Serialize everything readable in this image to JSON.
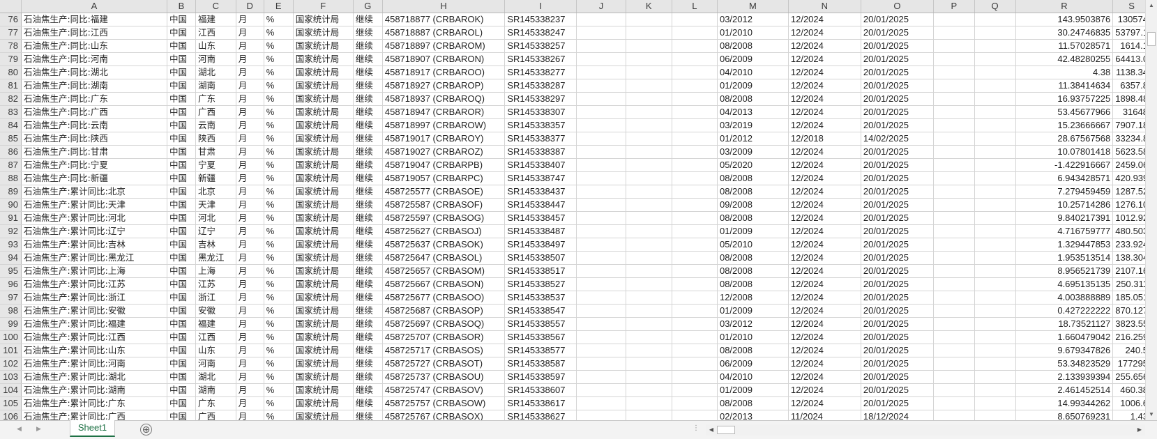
{
  "columns": [
    "A",
    "B",
    "C",
    "D",
    "E",
    "F",
    "G",
    "H",
    "I",
    "J",
    "K",
    "L",
    "M",
    "N",
    "O",
    "P",
    "Q",
    "R",
    "S"
  ],
  "rows": [
    {
      "n": "76",
      "a": "石油焦生产:同比:福建",
      "b": "中国",
      "c": "福建",
      "d": "月",
      "e": "%",
      "f": "国家统计局",
      "g": "继续",
      "h": "458718877 (CRBAROK)",
      "i": "SR145338237",
      "m": "03/2012",
      "nn": "12/2024",
      "o": "20/01/2025",
      "r": "143.9503876",
      "s": "130574"
    },
    {
      "n": "77",
      "a": "石油焦生产:同比:江西",
      "b": "中国",
      "c": "江西",
      "d": "月",
      "e": "%",
      "f": "国家统计局",
      "g": "继续",
      "h": "458718887 (CRBAROL)",
      "i": "SR145338247",
      "m": "01/2010",
      "nn": "12/2024",
      "o": "20/01/2025",
      "r": "30.24746835",
      "s": "53797.1"
    },
    {
      "n": "78",
      "a": "石油焦生产:同比:山东",
      "b": "中国",
      "c": "山东",
      "d": "月",
      "e": "%",
      "f": "国家统计局",
      "g": "继续",
      "h": "458718897 (CRBAROM)",
      "i": "SR145338257",
      "m": "08/2008",
      "nn": "12/2024",
      "o": "20/01/2025",
      "r": "11.57028571",
      "s": "1614.1"
    },
    {
      "n": "79",
      "a": "石油焦生产:同比:河南",
      "b": "中国",
      "c": "河南",
      "d": "月",
      "e": "%",
      "f": "国家统计局",
      "g": "继续",
      "h": "458718907 (CRBARON)",
      "i": "SR145338267",
      "m": "06/2009",
      "nn": "12/2024",
      "o": "20/01/2025",
      "r": "42.48280255",
      "s": "64413.0"
    },
    {
      "n": "80",
      "a": "石油焦生产:同比:湖北",
      "b": "中国",
      "c": "湖北",
      "d": "月",
      "e": "%",
      "f": "国家统计局",
      "g": "继续",
      "h": "458718917 (CRBAROO)",
      "i": "SR145338277",
      "m": "04/2010",
      "nn": "12/2024",
      "o": "20/01/2025",
      "r": "4.38",
      "s": "1138.34"
    },
    {
      "n": "81",
      "a": "石油焦生产:同比:湖南",
      "b": "中国",
      "c": "湖南",
      "d": "月",
      "e": "%",
      "f": "国家统计局",
      "g": "继续",
      "h": "458718927 (CRBAROP)",
      "i": "SR145338287",
      "m": "01/2009",
      "nn": "12/2024",
      "o": "20/01/2025",
      "r": "11.38414634",
      "s": "6357.8"
    },
    {
      "n": "82",
      "a": "石油焦生产:同比:广东",
      "b": "中国",
      "c": "广东",
      "d": "月",
      "e": "%",
      "f": "国家统计局",
      "g": "继续",
      "h": "458718937 (CRBAROQ)",
      "i": "SR145338297",
      "m": "08/2008",
      "nn": "12/2024",
      "o": "20/01/2025",
      "r": "16.93757225",
      "s": "1898.48"
    },
    {
      "n": "83",
      "a": "石油焦生产:同比:广西",
      "b": "中国",
      "c": "广西",
      "d": "月",
      "e": "%",
      "f": "国家统计局",
      "g": "继续",
      "h": "458718947 (CRBAROR)",
      "i": "SR145338307",
      "m": "04/2013",
      "nn": "12/2024",
      "o": "20/01/2025",
      "r": "53.45677966",
      "s": "31648"
    },
    {
      "n": "84",
      "a": "石油焦生产:同比:云南",
      "b": "中国",
      "c": "云南",
      "d": "月",
      "e": "%",
      "f": "国家统计局",
      "g": "继续",
      "h": "458718997 (CRBAROW)",
      "i": "SR145338357",
      "m": "03/2019",
      "nn": "12/2024",
      "o": "20/01/2025",
      "r": "15.23666667",
      "s": "7907.18"
    },
    {
      "n": "85",
      "a": "石油焦生产:同比:陕西",
      "b": "中国",
      "c": "陕西",
      "d": "月",
      "e": "%",
      "f": "国家统计局",
      "g": "继续",
      "h": "458719017 (CRBAROY)",
      "i": "SR145338377",
      "m": "01/2012",
      "nn": "12/2018",
      "o": "14/02/2025",
      "r": "28.67567568",
      "s": "33234.8"
    },
    {
      "n": "86",
      "a": "石油焦生产:同比:甘肃",
      "b": "中国",
      "c": "甘肃",
      "d": "月",
      "e": "%",
      "f": "国家统计局",
      "g": "继续",
      "h": "458719027 (CRBAROZ)",
      "i": "SR145338387",
      "m": "03/2009",
      "nn": "12/2024",
      "o": "20/01/2025",
      "r": "10.07801418",
      "s": "5623.58"
    },
    {
      "n": "87",
      "a": "石油焦生产:同比:宁夏",
      "b": "中国",
      "c": "宁夏",
      "d": "月",
      "e": "%",
      "f": "国家统计局",
      "g": "继续",
      "h": "458719047 (CRBARPB)",
      "i": "SR145338407",
      "m": "05/2020",
      "nn": "12/2024",
      "o": "20/01/2025",
      "r": "-1.422916667",
      "s": "2459.06"
    },
    {
      "n": "88",
      "a": "石油焦生产:同比:新疆",
      "b": "中国",
      "c": "新疆",
      "d": "月",
      "e": "%",
      "f": "国家统计局",
      "g": "继续",
      "h": "458719057 (CRBARPC)",
      "i": "SR145338747",
      "m": "08/2008",
      "nn": "12/2024",
      "o": "20/01/2025",
      "r": "6.943428571",
      "s": "420.939"
    },
    {
      "n": "89",
      "a": "石油焦生产:累计同比:北京",
      "b": "中国",
      "c": "北京",
      "d": "月",
      "e": "%",
      "f": "国家统计局",
      "g": "继续",
      "h": "458725577 (CRBASOE)",
      "i": "SR145338437",
      "m": "08/2008",
      "nn": "12/2024",
      "o": "20/01/2025",
      "r": "7.279459459",
      "s": "1287.52"
    },
    {
      "n": "90",
      "a": "石油焦生产:累计同比:天津",
      "b": "中国",
      "c": "天津",
      "d": "月",
      "e": "%",
      "f": "国家统计局",
      "g": "继续",
      "h": "458725587 (CRBASOF)",
      "i": "SR145338447",
      "m": "09/2008",
      "nn": "12/2024",
      "o": "20/01/2025",
      "r": "10.25714286",
      "s": "1276.10"
    },
    {
      "n": "91",
      "a": "石油焦生产:累计同比:河北",
      "b": "中国",
      "c": "河北",
      "d": "月",
      "e": "%",
      "f": "国家统计局",
      "g": "继续",
      "h": "458725597 (CRBASOG)",
      "i": "SR145338457",
      "m": "08/2008",
      "nn": "12/2024",
      "o": "20/01/2025",
      "r": "9.840217391",
      "s": "1012.92"
    },
    {
      "n": "92",
      "a": "石油焦生产:累计同比:辽宁",
      "b": "中国",
      "c": "辽宁",
      "d": "月",
      "e": "%",
      "f": "国家统计局",
      "g": "继续",
      "h": "458725627 (CRBASOJ)",
      "i": "SR145338487",
      "m": "01/2009",
      "nn": "12/2024",
      "o": "20/01/2025",
      "r": "4.716759777",
      "s": "480.503"
    },
    {
      "n": "93",
      "a": "石油焦生产:累计同比:吉林",
      "b": "中国",
      "c": "吉林",
      "d": "月",
      "e": "%",
      "f": "国家统计局",
      "g": "继续",
      "h": "458725637 (CRBASOK)",
      "i": "SR145338497",
      "m": "05/2010",
      "nn": "12/2024",
      "o": "20/01/2025",
      "r": "1.329447853",
      "s": "233.924"
    },
    {
      "n": "94",
      "a": "石油焦生产:累计同比:黑龙江",
      "b": "中国",
      "c": "黑龙江",
      "d": "月",
      "e": "%",
      "f": "国家统计局",
      "g": "继续",
      "h": "458725647 (CRBASOL)",
      "i": "SR145338507",
      "m": "08/2008",
      "nn": "12/2024",
      "o": "20/01/2025",
      "r": "1.953513514",
      "s": "138.304"
    },
    {
      "n": "95",
      "a": "石油焦生产:累计同比:上海",
      "b": "中国",
      "c": "上海",
      "d": "月",
      "e": "%",
      "f": "国家统计局",
      "g": "继续",
      "h": "458725657 (CRBASOM)",
      "i": "SR145338517",
      "m": "08/2008",
      "nn": "12/2024",
      "o": "20/01/2025",
      "r": "8.956521739",
      "s": "2107.16"
    },
    {
      "n": "96",
      "a": "石油焦生产:累计同比:江苏",
      "b": "中国",
      "c": "江苏",
      "d": "月",
      "e": "%",
      "f": "国家统计局",
      "g": "继续",
      "h": "458725667 (CRBASON)",
      "i": "SR145338527",
      "m": "08/2008",
      "nn": "12/2024",
      "o": "20/01/2025",
      "r": "4.695135135",
      "s": "250.311"
    },
    {
      "n": "97",
      "a": "石油焦生产:累计同比:浙江",
      "b": "中国",
      "c": "浙江",
      "d": "月",
      "e": "%",
      "f": "国家统计局",
      "g": "继续",
      "h": "458725677 (CRBASOO)",
      "i": "SR145338537",
      "m": "12/2008",
      "nn": "12/2024",
      "o": "20/01/2025",
      "r": "4.003888889",
      "s": "185.051"
    },
    {
      "n": "98",
      "a": "石油焦生产:累计同比:安徽",
      "b": "中国",
      "c": "安徽",
      "d": "月",
      "e": "%",
      "f": "国家统计局",
      "g": "继续",
      "h": "458725687 (CRBASOP)",
      "i": "SR145338547",
      "m": "01/2009",
      "nn": "12/2024",
      "o": "20/01/2025",
      "r": "0.427222222",
      "s": "870.127"
    },
    {
      "n": "99",
      "a": "石油焦生产:累计同比:福建",
      "b": "中国",
      "c": "福建",
      "d": "月",
      "e": "%",
      "f": "国家统计局",
      "g": "继续",
      "h": "458725697 (CRBASOQ)",
      "i": "SR145338557",
      "m": "03/2012",
      "nn": "12/2024",
      "o": "20/01/2025",
      "r": "18.73521127",
      "s": "3823.55"
    },
    {
      "n": "100",
      "a": "石油焦生产:累计同比:江西",
      "b": "中国",
      "c": "江西",
      "d": "月",
      "e": "%",
      "f": "国家统计局",
      "g": "继续",
      "h": "458725707 (CRBASOR)",
      "i": "SR145338567",
      "m": "01/2010",
      "nn": "12/2024",
      "o": "20/01/2025",
      "r": "1.660479042",
      "s": "216.259"
    },
    {
      "n": "101",
      "a": "石油焦生产:累计同比:山东",
      "b": "中国",
      "c": "山东",
      "d": "月",
      "e": "%",
      "f": "国家统计局",
      "g": "继续",
      "h": "458725717 (CRBASOS)",
      "i": "SR145338577",
      "m": "08/2008",
      "nn": "12/2024",
      "o": "20/01/2025",
      "r": "9.679347826",
      "s": "240.5"
    },
    {
      "n": "102",
      "a": "石油焦生产:累计同比:河南",
      "b": "中国",
      "c": "河南",
      "d": "月",
      "e": "%",
      "f": "国家统计局",
      "g": "继续",
      "h": "458725727 (CRBASOT)",
      "i": "SR145338587",
      "m": "06/2009",
      "nn": "12/2024",
      "o": "20/01/2025",
      "r": "53.34823529",
      "s": "177295"
    },
    {
      "n": "103",
      "a": "石油焦生产:累计同比:湖北",
      "b": "中国",
      "c": "湖北",
      "d": "月",
      "e": "%",
      "f": "国家统计局",
      "g": "继续",
      "h": "458725737 (CRBASOU)",
      "i": "SR145338597",
      "m": "04/2010",
      "nn": "12/2024",
      "o": "20/01/2025",
      "r": "2.133939394",
      "s": "255.656"
    },
    {
      "n": "104",
      "a": "石油焦生产:累计同比:湖南",
      "b": "中国",
      "c": "湖南",
      "d": "月",
      "e": "%",
      "f": "国家统计局",
      "g": "继续",
      "h": "458725747 (CRBASOV)",
      "i": "SR145338607",
      "m": "01/2009",
      "nn": "12/2024",
      "o": "20/01/2025",
      "r": "2.461452514",
      "s": "460.38"
    },
    {
      "n": "105",
      "a": "石油焦生产:累计同比:广东",
      "b": "中国",
      "c": "广东",
      "d": "月",
      "e": "%",
      "f": "国家统计局",
      "g": "继续",
      "h": "458725757 (CRBASOW)",
      "i": "SR145338617",
      "m": "08/2008",
      "nn": "12/2024",
      "o": "20/01/2025",
      "r": "14.99344262",
      "s": "1006.6"
    },
    {
      "n": "106",
      "a": "石油焦生产:累计同比:广西",
      "b": "中国",
      "c": "广西",
      "d": "月",
      "e": "%",
      "f": "国家统计局",
      "g": "继续",
      "h": "458725767 (CRBASOX)",
      "i": "SR145338627",
      "m": "02/2013",
      "nn": "11/2024",
      "o": "18/12/2024",
      "r": "8.650769231",
      "s": "1.43"
    }
  ],
  "tabbar": {
    "sheet_tab": "Sheet1",
    "add_sheet_symbol": "⊕",
    "prev_symbol": "◀",
    "next_symbol": "▶",
    "split_symbol": "⋮"
  },
  "colors": {
    "accent": "#1e7145",
    "header_bg": "#e6e6e6",
    "gridline": "#d4d4d4"
  }
}
